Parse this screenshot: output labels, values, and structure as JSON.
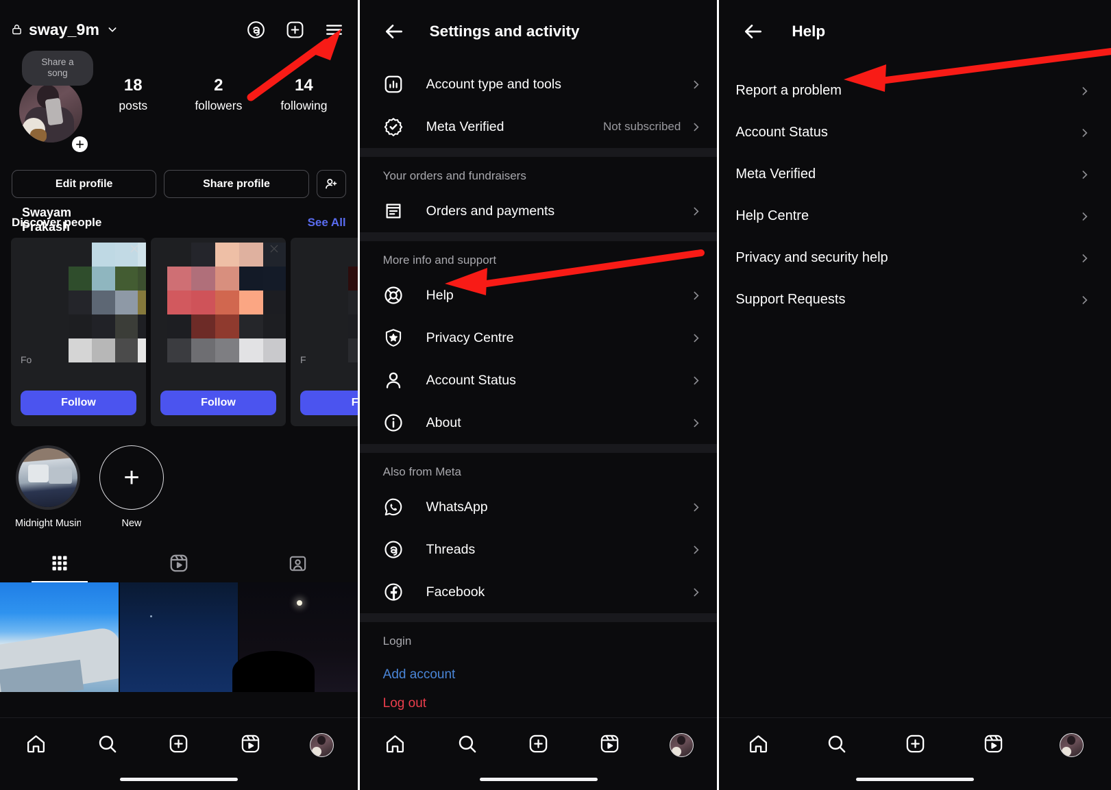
{
  "profile": {
    "username": "sway_9m",
    "display_name": "Swayam Prakash",
    "song_bubble": "Share a song",
    "stats": [
      {
        "num": "18",
        "label": "posts"
      },
      {
        "num": "2",
        "label": "followers"
      },
      {
        "num": "14",
        "label": "following"
      }
    ],
    "edit_profile_label": "Edit profile",
    "share_profile_label": "Share profile",
    "icons": {
      "lock": "lock-icon",
      "chevron": "chevron-down-icon",
      "threads": "threads-icon",
      "new_post": "plus-square-icon",
      "menu": "hamburger-menu-icon",
      "add_person": "add-person-icon",
      "avatar_plus": "+"
    },
    "discover": {
      "title": "Discover people",
      "see_all": "See All",
      "cards": [
        {
          "name": "Fo",
          "follow": "Follow"
        },
        {
          "name": "",
          "follow": "Follow"
        },
        {
          "name": "F",
          "follow": "Fo"
        }
      ]
    },
    "highlights": [
      {
        "label": "Midnight Musin…"
      },
      {
        "label": "New"
      }
    ],
    "tabs": [
      {
        "name": "grid-tab",
        "icon": "grid-icon",
        "active": true
      },
      {
        "name": "reels-tab",
        "icon": "reels-icon",
        "active": false
      },
      {
        "name": "tagged-tab",
        "icon": "tagged-icon",
        "active": false
      }
    ]
  },
  "settings": {
    "title": "Settings and activity",
    "back": "back-arrow-icon",
    "groups": [
      {
        "header": null,
        "items": [
          {
            "label": "Account type and tools",
            "icon": "bar-chart-icon",
            "value": null
          },
          {
            "label": "Meta Verified",
            "icon": "meta-verified-badge-icon",
            "value": "Not subscribed"
          }
        ]
      },
      {
        "header": "Your orders and fundraisers",
        "items": [
          {
            "label": "Orders and payments",
            "icon": "receipt-icon",
            "value": null
          }
        ]
      },
      {
        "header": "More info and support",
        "items": [
          {
            "label": "Help",
            "icon": "lifebuoy-icon",
            "value": null
          },
          {
            "label": "Privacy Centre",
            "icon": "shield-star-icon",
            "value": null
          },
          {
            "label": "Account Status",
            "icon": "person-icon",
            "value": null
          },
          {
            "label": "About",
            "icon": "info-circle-icon",
            "value": null
          }
        ]
      },
      {
        "header": "Also from Meta",
        "items": [
          {
            "label": "WhatsApp",
            "icon": "whatsapp-icon",
            "value": null
          },
          {
            "label": "Threads",
            "icon": "threads-icon",
            "value": null
          },
          {
            "label": "Facebook",
            "icon": "facebook-icon",
            "value": null
          }
        ]
      }
    ],
    "login_header": "Login",
    "add_account": "Add account",
    "log_out": "Log out"
  },
  "help": {
    "title": "Help",
    "back": "back-arrow-icon",
    "items": [
      {
        "label": "Report a problem"
      },
      {
        "label": "Account Status"
      },
      {
        "label": "Meta Verified"
      },
      {
        "label": "Help Centre"
      },
      {
        "label": "Privacy and security help"
      },
      {
        "label": "Support Requests"
      }
    ]
  },
  "bottom_nav": [
    {
      "name": "home-icon"
    },
    {
      "name": "search-icon"
    },
    {
      "name": "create-icon"
    },
    {
      "name": "reels-icon"
    },
    {
      "name": "profile-avatar"
    }
  ],
  "annotations": {
    "color": "#f81b16",
    "arrows": [
      {
        "target": "hamburger-menu-icon",
        "panel": "profile"
      },
      {
        "target": "Help",
        "panel": "settings"
      },
      {
        "target": "Report a problem",
        "panel": "help"
      }
    ]
  },
  "colors": {
    "background": "#0b0b0d",
    "follow_blue": "#4b54ef",
    "link_blue": "#4a86d8",
    "see_all": "#5a6cf0",
    "logout_red": "#ec3e4c",
    "annotation_red": "#f81b16"
  }
}
